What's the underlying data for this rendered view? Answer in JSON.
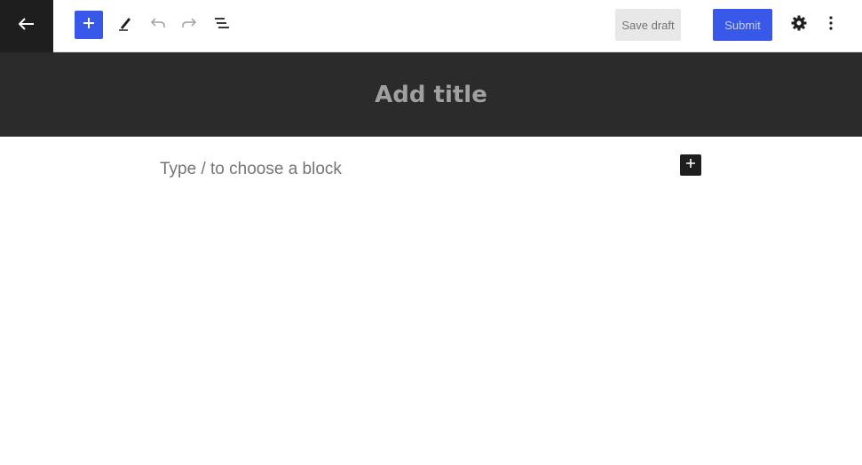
{
  "toolbar": {
    "back_icon": "arrow-left-icon",
    "inserter_icon": "plus-icon",
    "tools_icon": "pencil-icon",
    "undo_icon": "undo-icon",
    "redo_icon": "redo-icon",
    "outline_icon": "list-view-icon",
    "save_draft_label": "Save draft",
    "submit_label": "Submit",
    "settings_icon": "gear-icon",
    "options_icon": "more-vertical-icon"
  },
  "editor": {
    "title_placeholder": "Add title",
    "block_placeholder": "Type / to choose a block",
    "block_add_icon": "plus-icon"
  },
  "colors": {
    "accent": "#3858e9",
    "dark": "#1e1e1e",
    "title_band": "#2b2b2b"
  }
}
